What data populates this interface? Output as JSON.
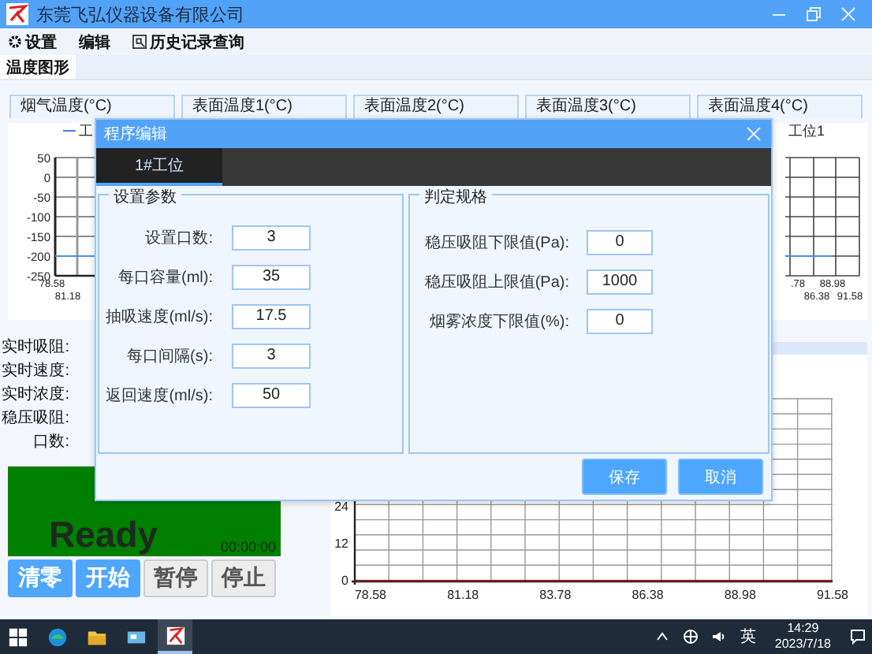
{
  "window": {
    "title": "东莞飞弘仪器设备有限公司"
  },
  "menu": [
    {
      "label": "设置",
      "kind": "gear"
    },
    {
      "label": "编辑",
      "kind": "plain"
    },
    {
      "label": "历史记录查询",
      "kind": "search"
    }
  ],
  "tabs": [
    {
      "label": "温度图形",
      "selected": true
    }
  ],
  "groups": [
    "烟气温度(°C)",
    "表面温度1(°C)",
    "表面温度2(°C)",
    "表面温度3(°C)",
    "表面温度4(°C)"
  ],
  "left_chart": {
    "legend": "工",
    "y_ticks": [
      "50",
      "0",
      "-50",
      "-100",
      "-150",
      "-200",
      "-250"
    ],
    "x_ticks": [
      "78.58",
      "81.18"
    ]
  },
  "right_chart": {
    "legend": "工位1",
    "x_ticks": [
      ".78",
      "86.38",
      "88.98",
      "91.58"
    ]
  },
  "readouts": [
    "实时吸阻:",
    "实时速度:",
    "实时浓度:",
    "稳压吸阻:",
    "口数:"
  ],
  "status": {
    "text": "Ready",
    "timer": "00:00:00"
  },
  "buttons": [
    {
      "label": "清零",
      "active": true
    },
    {
      "label": "开始",
      "active": true
    },
    {
      "label": "暂停",
      "active": false
    },
    {
      "label": "停止",
      "active": false
    }
  ],
  "main_chart": {
    "y_ticks": [
      "24",
      "12",
      "0"
    ],
    "x_ticks": [
      "78.58",
      "81.18",
      "83.78",
      "86.38",
      "88.98",
      "91.58"
    ]
  },
  "dialog": {
    "title": "程序编辑",
    "tabs": [
      {
        "label": "1#工位",
        "selected": true
      }
    ],
    "groups": [
      {
        "title": "设置参数",
        "fields": [
          {
            "label": "设置口数:",
            "value": "3"
          },
          {
            "label": "每口容量(ml):",
            "value": "35"
          },
          {
            "label": "抽吸速度(ml/s):",
            "value": "17.5"
          },
          {
            "label": "每口间隔(s):",
            "value": "3"
          },
          {
            "label": "返回速度(ml/s):",
            "value": "50"
          }
        ]
      },
      {
        "title": "判定规格",
        "fields": [
          {
            "label": "稳压吸阻下限值(Pa):",
            "value": "0"
          },
          {
            "label": "稳压吸阻上限值(Pa):",
            "value": "1000"
          },
          {
            "label": "烟雾浓度下限值(%):",
            "value": "0"
          }
        ]
      }
    ],
    "buttons": [
      "保存",
      "取消"
    ]
  },
  "taskbar": {
    "input_method": "英",
    "time": "14:29",
    "date": "2023/7/18"
  }
}
